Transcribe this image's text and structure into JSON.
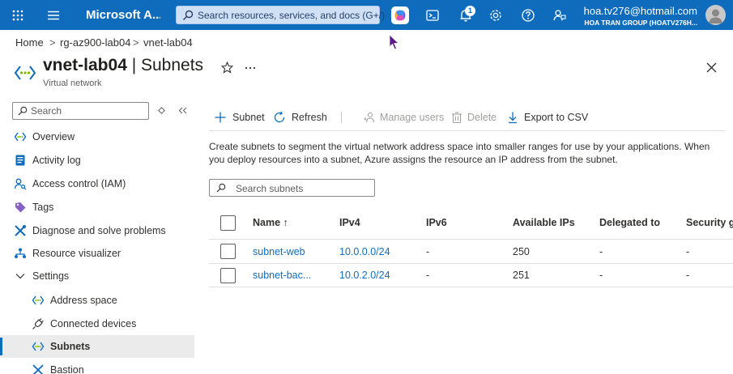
{
  "topbar": {
    "brand": "Microsoft A...",
    "search_placeholder": "Search resources, services, and docs (G+/)",
    "notification_count": "1",
    "account_email": "hoa.tv276@hotmail.com",
    "account_org": "HOA TRAN GROUP (HOATV276H..."
  },
  "breadcrumb": [
    "Home",
    "rg-az900-lab04",
    "vnet-lab04"
  ],
  "header": {
    "resource_name": "vnet-lab04",
    "separator": " | ",
    "page": "Subnets",
    "subtitle": "Virtual network"
  },
  "sidebar": {
    "search_placeholder": "Search",
    "items": [
      {
        "label": "Overview",
        "icon": "vnet-icon"
      },
      {
        "label": "Activity log",
        "icon": "activity-log-icon"
      },
      {
        "label": "Access control (IAM)",
        "icon": "iam-icon"
      },
      {
        "label": "Tags",
        "icon": "tag-icon"
      },
      {
        "label": "Diagnose and solve problems",
        "icon": "wrench-icon"
      },
      {
        "label": "Resource visualizer",
        "icon": "visualizer-icon"
      },
      {
        "label": "Settings",
        "icon": "chevron-down-icon"
      },
      {
        "label": "Address space",
        "icon": "vnet-icon"
      },
      {
        "label": "Connected devices",
        "icon": "plug-icon"
      },
      {
        "label": "Subnets",
        "icon": "vnet-icon"
      },
      {
        "label": "Bastion",
        "icon": "bastion-icon"
      }
    ]
  },
  "toolbar": {
    "add_subnet": "Subnet",
    "refresh": "Refresh",
    "manage_users": "Manage users",
    "delete": "Delete",
    "export": "Export to CSV"
  },
  "description": "Create subnets to segment the virtual network address space into smaller ranges for use by your applications. When you deploy resources into a subnet, Azure assigns the resource an IP address from the subnet.",
  "subnet_search_placeholder": "Search subnets",
  "table": {
    "columns": [
      "Name ↑",
      "IPv4",
      "IPv6",
      "Available IPs",
      "Delegated to",
      "Security gr"
    ],
    "rows": [
      {
        "name": "subnet-web",
        "ipv4": "10.0.0.0/24",
        "ipv6": "-",
        "available": "250",
        "delegated": "-",
        "security": "-"
      },
      {
        "name": "subnet-bac...",
        "ipv4": "10.0.2.0/24",
        "ipv6": "-",
        "available": "251",
        "delegated": "-",
        "security": "-"
      }
    ]
  },
  "colors": {
    "accent": "#0f6cbd",
    "topbar": "#0f6cbd",
    "selected_nav": "#ebebeb"
  }
}
